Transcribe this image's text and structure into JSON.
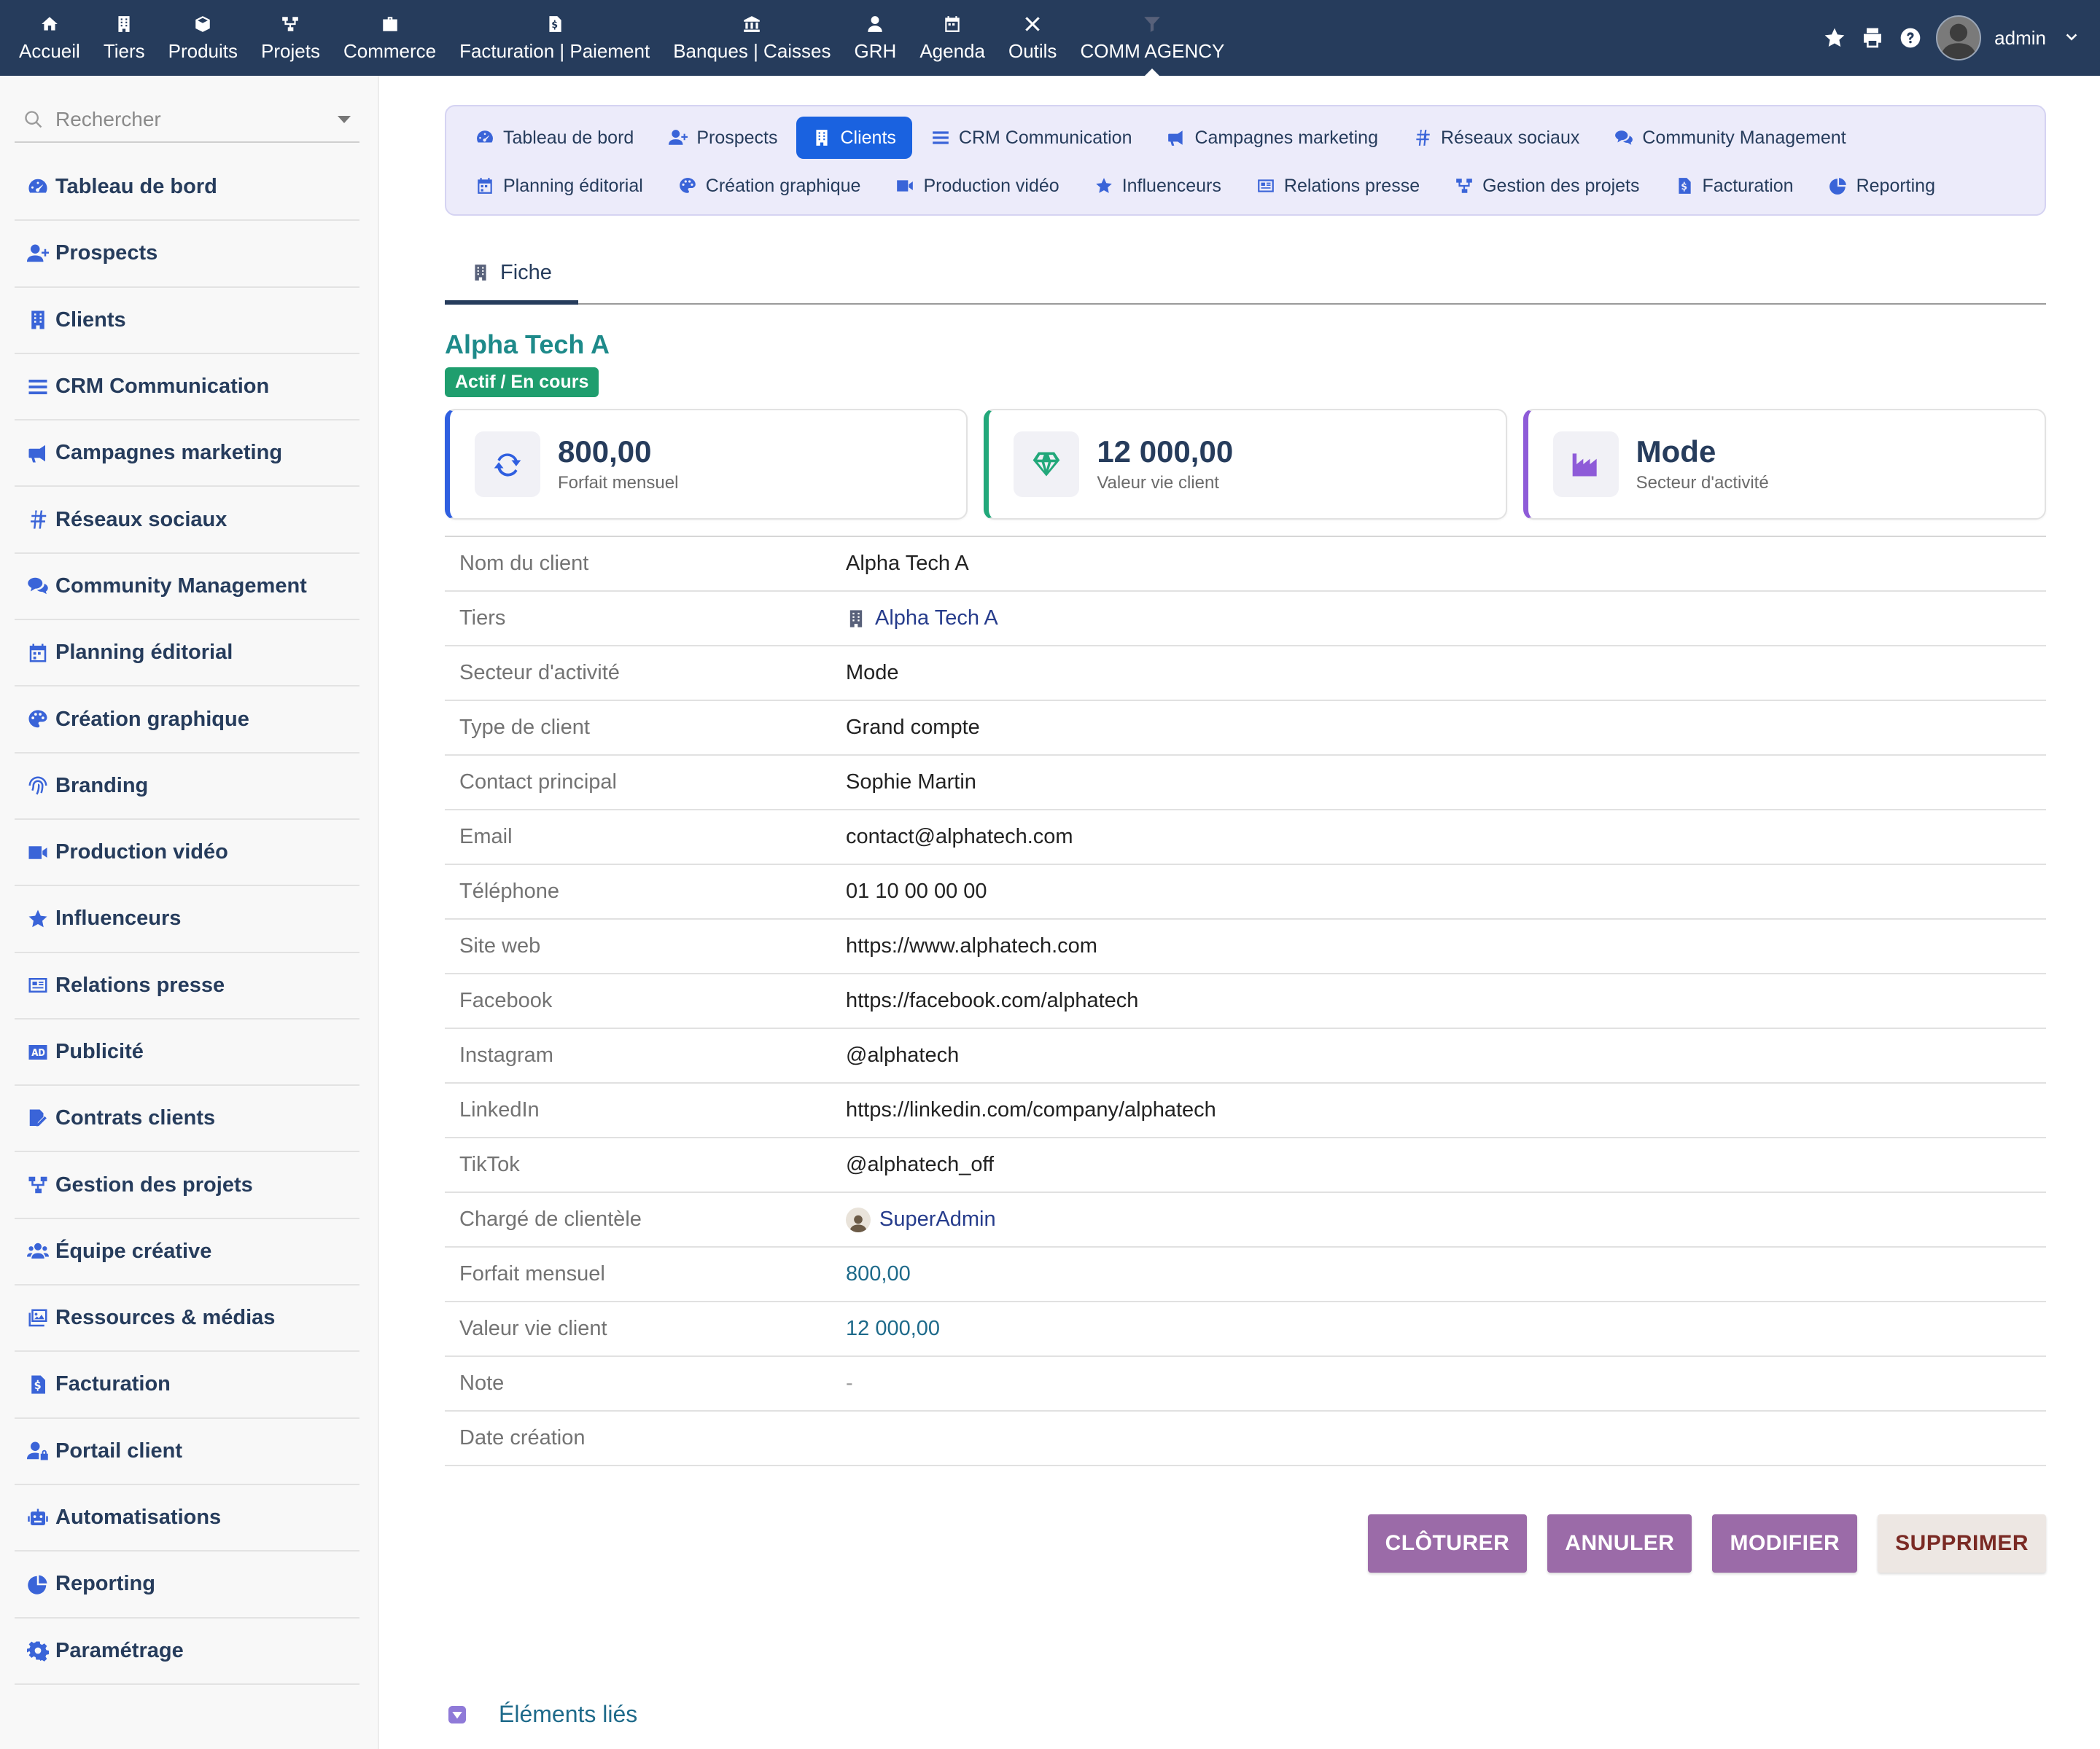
{
  "topnav": {
    "items": [
      {
        "label": "Accueil",
        "icon": "home-icon"
      },
      {
        "label": "Tiers",
        "icon": "building-icon"
      },
      {
        "label": "Produits",
        "icon": "cube-icon"
      },
      {
        "label": "Projets",
        "icon": "sitemap-icon"
      },
      {
        "label": "Commerce",
        "icon": "briefcase-icon"
      },
      {
        "label": "Facturation | Paiement",
        "icon": "invoice-icon"
      },
      {
        "label": "Banques | Caisses",
        "icon": "bank-icon"
      },
      {
        "label": "GRH",
        "icon": "user-tie-icon"
      },
      {
        "label": "Agenda",
        "icon": "calendar-icon"
      },
      {
        "label": "Outils",
        "icon": "tools-icon"
      },
      {
        "label": "COMM AGENCY",
        "icon": "funnel-icon",
        "active": true
      }
    ],
    "right": {
      "user": "admin"
    }
  },
  "sidebar": {
    "search_placeholder": "Rechercher",
    "items": [
      {
        "label": "Tableau de bord",
        "icon": "dashboard-icon"
      },
      {
        "label": "Prospects",
        "icon": "user-plus-icon"
      },
      {
        "label": "Clients",
        "icon": "building-icon"
      },
      {
        "label": "CRM Communication",
        "icon": "list-icon"
      },
      {
        "label": "Campagnes marketing",
        "icon": "bullhorn-icon"
      },
      {
        "label": "Réseaux sociaux",
        "icon": "hashtag-icon"
      },
      {
        "label": "Community Management",
        "icon": "comments-icon"
      },
      {
        "label": "Planning éditorial",
        "icon": "calendar-icon"
      },
      {
        "label": "Création graphique",
        "icon": "palette-icon"
      },
      {
        "label": "Branding",
        "icon": "fingerprint-icon"
      },
      {
        "label": "Production vidéo",
        "icon": "video-icon"
      },
      {
        "label": "Influenceurs",
        "icon": "star-icon"
      },
      {
        "label": "Relations presse",
        "icon": "newspaper-icon"
      },
      {
        "label": "Publicité",
        "icon": "ad-icon"
      },
      {
        "label": "Contrats clients",
        "icon": "contract-icon"
      },
      {
        "label": "Gestion des projets",
        "icon": "sitemap-icon"
      },
      {
        "label": "Équipe créative",
        "icon": "users-icon"
      },
      {
        "label": "Ressources & médias",
        "icon": "images-icon"
      },
      {
        "label": "Facturation",
        "icon": "invoice-icon"
      },
      {
        "label": "Portail client",
        "icon": "user-lock-icon"
      },
      {
        "label": "Automatisations",
        "icon": "robot-icon"
      },
      {
        "label": "Reporting",
        "icon": "chart-pie-icon"
      },
      {
        "label": "Paramétrage",
        "icon": "gear-icon"
      }
    ]
  },
  "subnav": {
    "row1": [
      {
        "label": "Tableau de bord",
        "icon": "dashboard-icon"
      },
      {
        "label": "Prospects",
        "icon": "user-plus-icon"
      },
      {
        "label": "Clients",
        "icon": "building-icon",
        "active": true
      },
      {
        "label": "CRM Communication",
        "icon": "list-icon"
      },
      {
        "label": "Campagnes marketing",
        "icon": "bullhorn-icon"
      },
      {
        "label": "Réseaux sociaux",
        "icon": "hashtag-icon"
      },
      {
        "label": "Community Management",
        "icon": "comments-icon"
      }
    ],
    "row2": [
      {
        "label": "Planning éditorial",
        "icon": "calendar-icon"
      },
      {
        "label": "Création graphique",
        "icon": "palette-icon"
      },
      {
        "label": "Production vidéo",
        "icon": "video-icon"
      },
      {
        "label": "Influenceurs",
        "icon": "star-icon"
      },
      {
        "label": "Relations presse",
        "icon": "newspaper-icon"
      },
      {
        "label": "Gestion des projets",
        "icon": "sitemap-icon"
      },
      {
        "label": "Facturation",
        "icon": "invoice-icon"
      },
      {
        "label": "Reporting",
        "icon": "chart-pie-icon"
      }
    ]
  },
  "tab": {
    "label": "Fiche"
  },
  "record": {
    "title": "Alpha Tech A",
    "status": "Actif / En cours"
  },
  "cards": [
    {
      "value": "800,00",
      "label": "Forfait mensuel",
      "icon": "sync-icon",
      "accent": "#2f5fe0"
    },
    {
      "value": "12 000,00",
      "label": "Valeur vie client",
      "icon": "gem-icon",
      "accent": "#22a87a"
    },
    {
      "value": "Mode",
      "label": "Secteur d'activité",
      "icon": "industry-icon",
      "accent": "#8e5bd8"
    }
  ],
  "details": [
    {
      "label": "Nom du client",
      "value": "Alpha Tech A"
    },
    {
      "label": "Tiers",
      "value": "Alpha Tech A"
    },
    {
      "label": "Secteur d'activité",
      "value": "Mode"
    },
    {
      "label": "Type de client",
      "value": "Grand compte"
    },
    {
      "label": "Contact principal",
      "value": "Sophie Martin"
    },
    {
      "label": "Email",
      "value": "contact@alphatech.com"
    },
    {
      "label": "Téléphone",
      "value": "01 10 00 00 00"
    },
    {
      "label": "Site web",
      "value": "https://www.alphatech.com"
    },
    {
      "label": "Facebook",
      "value": "https://facebook.com/alphatech"
    },
    {
      "label": "Instagram",
      "value": "@alphatech"
    },
    {
      "label": "LinkedIn",
      "value": "https://linkedin.com/company/alphatech"
    },
    {
      "label": "TikTok",
      "value": "@alphatech_off"
    },
    {
      "label": "Chargé de clientèle",
      "value": "SuperAdmin"
    },
    {
      "label": "Forfait mensuel",
      "value": "800,00"
    },
    {
      "label": "Valeur vie client",
      "value": "12 000,00"
    },
    {
      "label": "Note",
      "value": "-"
    },
    {
      "label": "Date création",
      "value": ""
    }
  ],
  "actions": {
    "close": "CLÔTURER",
    "cancel": "ANNULER",
    "edit": "MODIFIER",
    "delete": "SUPPRIMER"
  },
  "linked": {
    "label": "Éléments liés"
  },
  "colors": {
    "topbar": "#263c5c",
    "accent_blue": "#1a62e0",
    "title_teal": "#1e8a8a",
    "status_green": "#1f9e6e",
    "button_purple": "#9b6ba8"
  }
}
